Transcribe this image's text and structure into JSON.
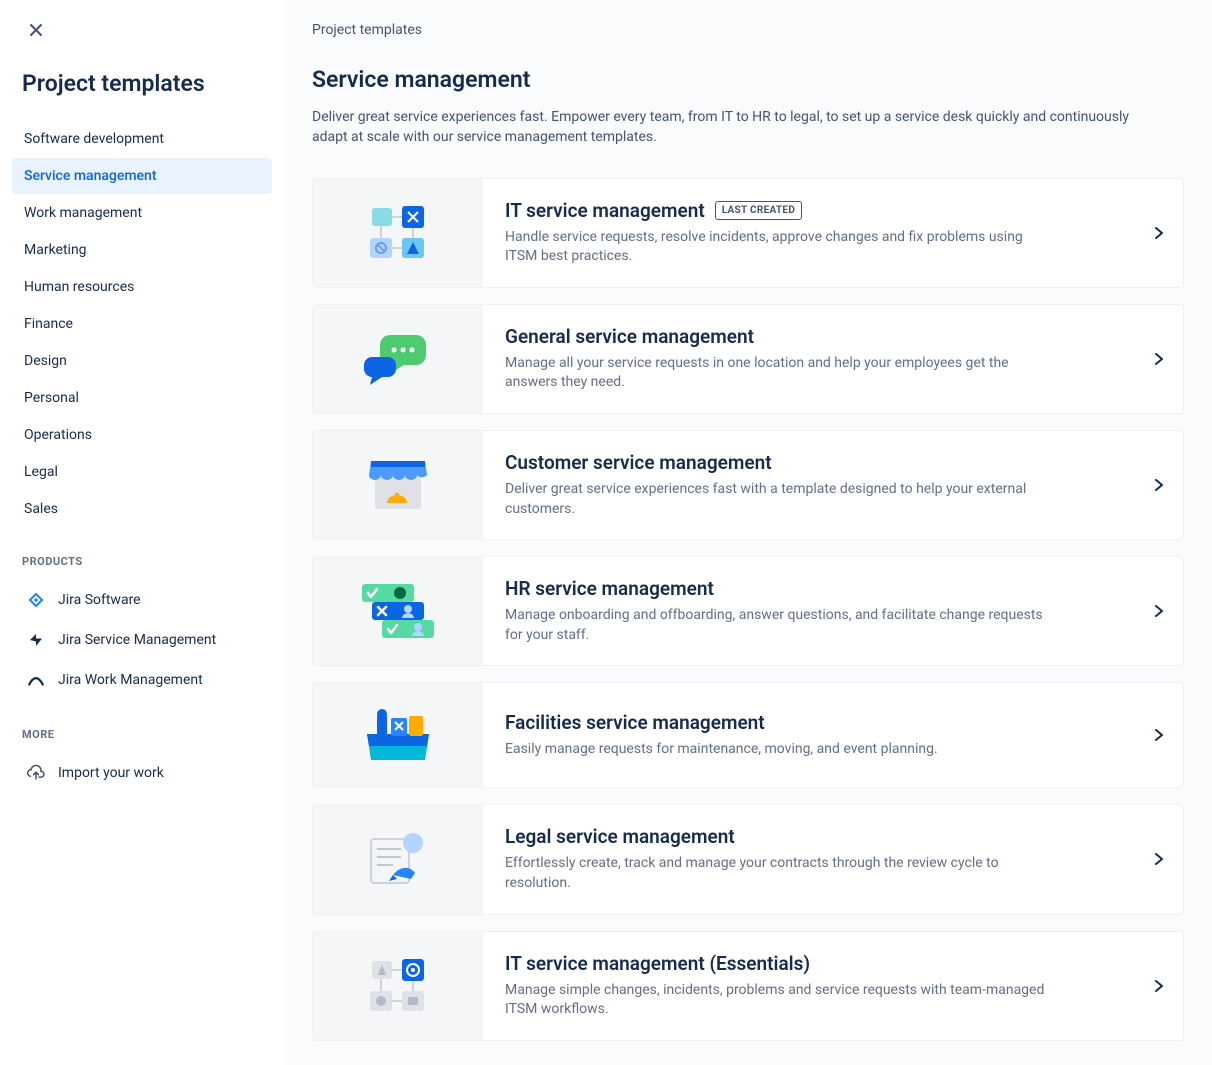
{
  "sidebar": {
    "title": "Project templates",
    "categories": [
      {
        "label": "Software development",
        "active": false
      },
      {
        "label": "Service management",
        "active": true
      },
      {
        "label": "Work management",
        "active": false
      },
      {
        "label": "Marketing",
        "active": false
      },
      {
        "label": "Human resources",
        "active": false
      },
      {
        "label": "Finance",
        "active": false
      },
      {
        "label": "Design",
        "active": false
      },
      {
        "label": "Personal",
        "active": false
      },
      {
        "label": "Operations",
        "active": false
      },
      {
        "label": "Legal",
        "active": false
      },
      {
        "label": "Sales",
        "active": false
      }
    ],
    "products_header": "PRODUCTS",
    "products": [
      {
        "label": "Jira Software"
      },
      {
        "label": "Jira Service Management"
      },
      {
        "label": "Jira Work Management"
      }
    ],
    "more_header": "MORE",
    "import_label": "Import your work"
  },
  "main": {
    "breadcrumb": "Project templates",
    "title": "Service management",
    "description": "Deliver great service experiences fast. Empower every team, from IT to HR to legal, to set up a service desk quickly and continuously adapt at scale with our service management templates.",
    "templates": [
      {
        "title": "IT service management",
        "badge": "LAST CREATED",
        "description": "Handle service requests, resolve incidents, approve changes and fix problems using ITSM best practices."
      },
      {
        "title": "General service management",
        "badge": null,
        "description": "Manage all your service requests in one location and help your employees get the answers they need."
      },
      {
        "title": "Customer service management",
        "badge": null,
        "description": "Deliver great service experiences fast with a template designed to help your external customers."
      },
      {
        "title": "HR service management",
        "badge": null,
        "description": "Manage onboarding and offboarding, answer questions, and facilitate change requests for your staff."
      },
      {
        "title": "Facilities service management",
        "badge": null,
        "description": "Easily manage requests for maintenance, moving, and event planning."
      },
      {
        "title": "Legal service management",
        "badge": null,
        "description": "Effortlessly create, track and manage your contracts through the review cycle to resolution."
      },
      {
        "title": "IT service management (Essentials)",
        "badge": null,
        "description": "Manage simple changes, incidents, problems and service requests with team-managed ITSM workflows."
      }
    ]
  }
}
